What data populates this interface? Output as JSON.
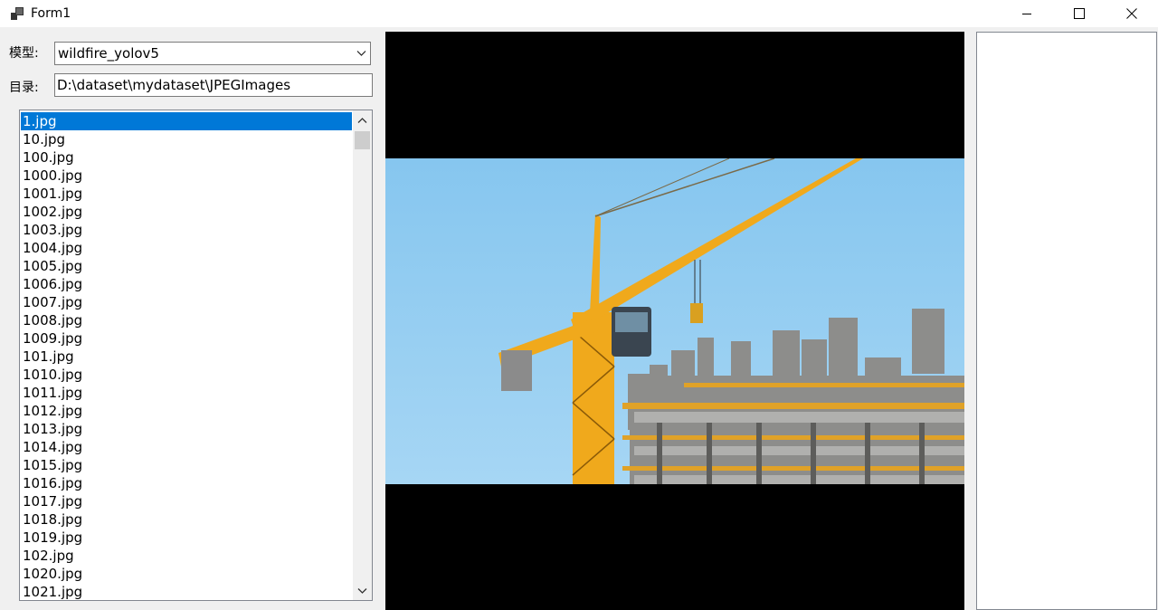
{
  "window": {
    "title": "Form1"
  },
  "model": {
    "label": "模型:",
    "value": "wildfire_yolov5"
  },
  "directory": {
    "label": "目录:",
    "value": "D:\\dataset\\mydataset\\JPEGImages"
  },
  "files": {
    "selected_index": 0,
    "items": [
      "1.jpg",
      "10.jpg",
      "100.jpg",
      "1000.jpg",
      "1001.jpg",
      "1002.jpg",
      "1003.jpg",
      "1004.jpg",
      "1005.jpg",
      "1006.jpg",
      "1007.jpg",
      "1008.jpg",
      "1009.jpg",
      "101.jpg",
      "1010.jpg",
      "1011.jpg",
      "1012.jpg",
      "1013.jpg",
      "1014.jpg",
      "1015.jpg",
      "1016.jpg",
      "1017.jpg",
      "1018.jpg",
      "1019.jpg",
      "102.jpg",
      "1020.jpg",
      "1021.jpg"
    ]
  },
  "colors": {
    "selection": "#0078d7",
    "sky": "#8ec9ee",
    "crane": "#f0a91c",
    "concrete": "#9a9a98"
  }
}
